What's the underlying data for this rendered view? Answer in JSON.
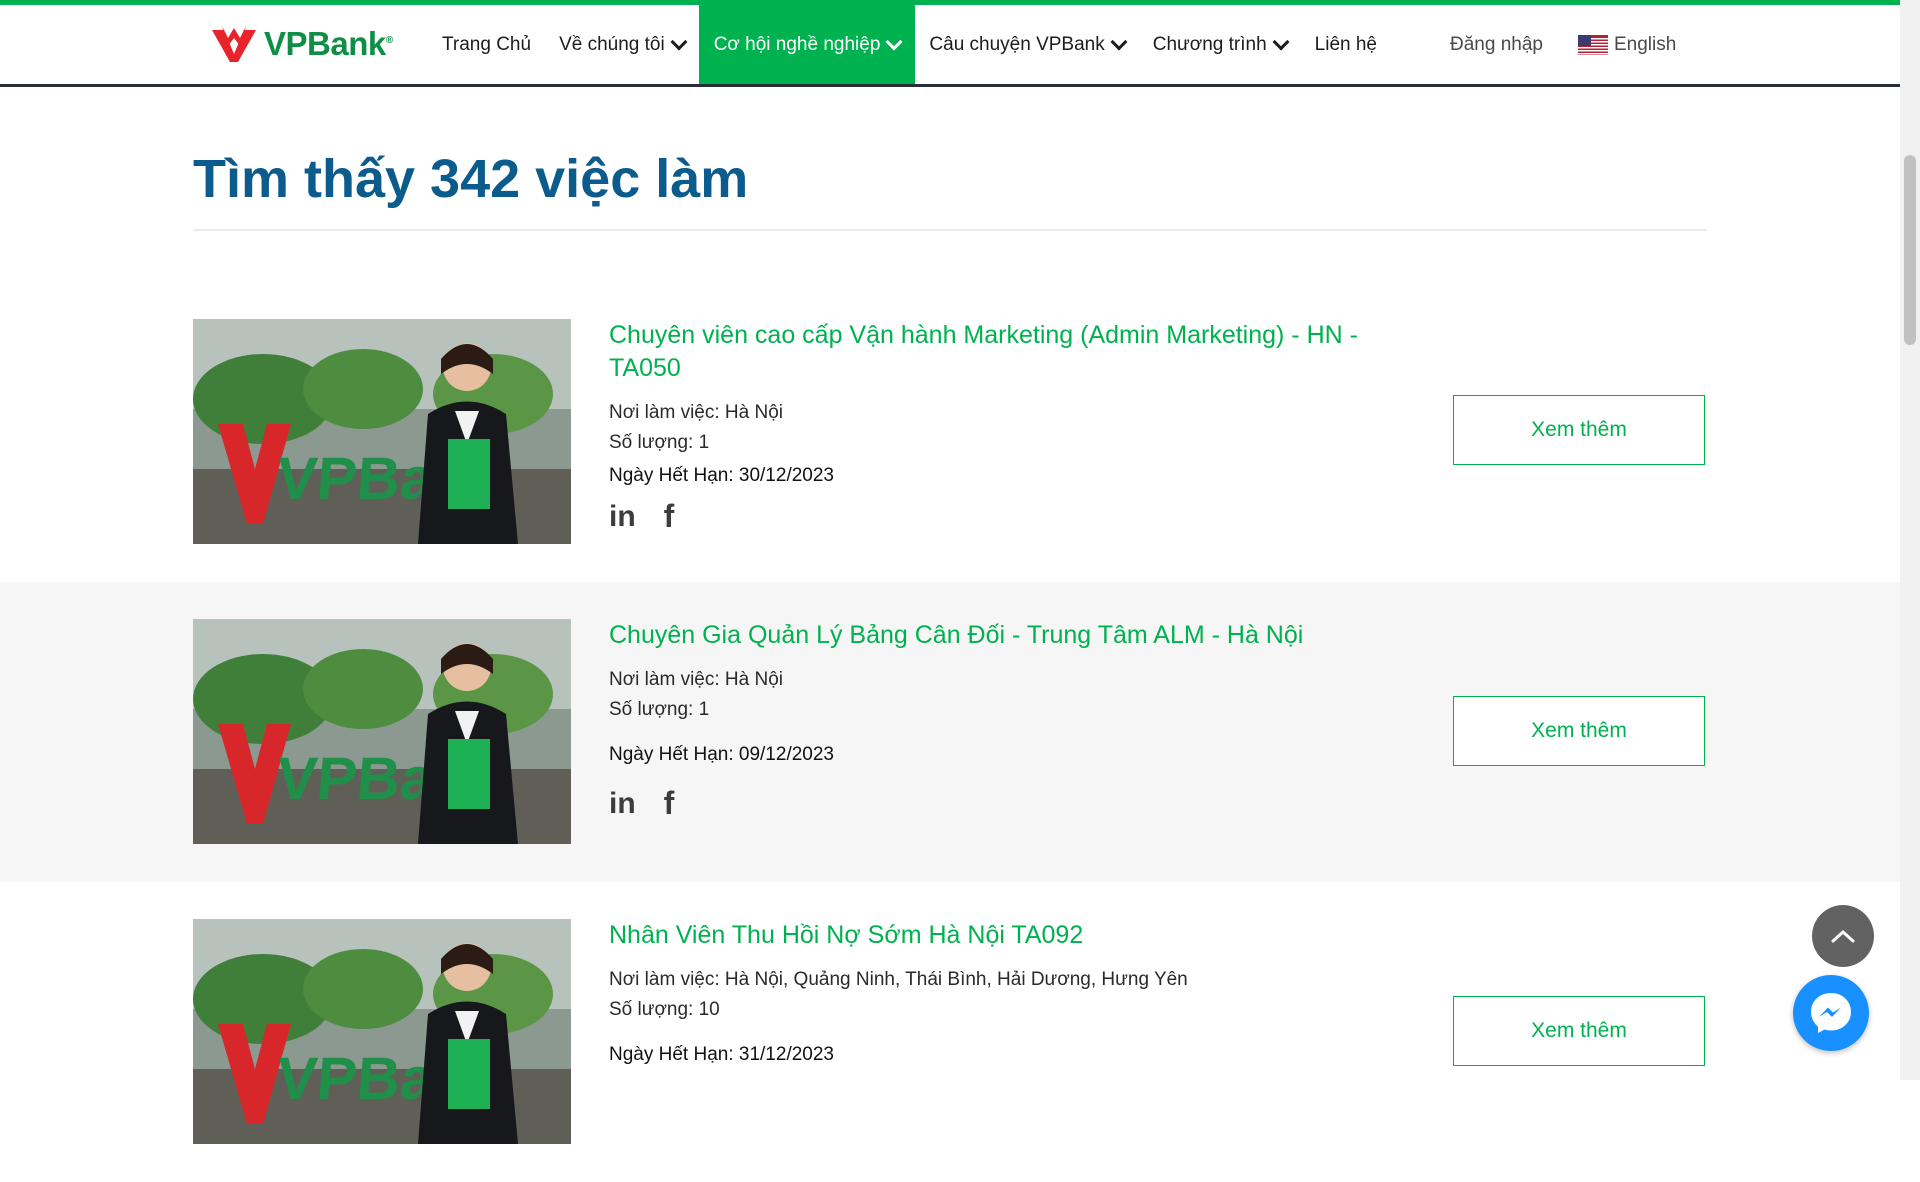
{
  "brand": {
    "name": "VPBank",
    "accent": "#00b14f",
    "logo_red": "#e8232a"
  },
  "nav": {
    "items": [
      {
        "label": "Trang Chủ",
        "dropdown": false,
        "active": false
      },
      {
        "label": "Về chúng tôi",
        "dropdown": true,
        "active": false
      },
      {
        "label": "Cơ hội nghề nghiệp",
        "dropdown": true,
        "active": true
      },
      {
        "label": "Câu chuyện VPBank",
        "dropdown": true,
        "active": false
      },
      {
        "label": "Chương trình",
        "dropdown": true,
        "active": false
      },
      {
        "label": "Liên hệ",
        "dropdown": false,
        "active": false
      }
    ],
    "login": "Đăng nhập",
    "language": "English"
  },
  "page": {
    "title": "Tìm thấy 342 việc làm"
  },
  "jobs": [
    {
      "title": "Chuyên viên cao cấp Vận hành Marketing (Admin Marketing) - HN - TA050",
      "location": "Nơi làm việc: Hà Nội",
      "quantity": "Số lượng: 1",
      "deadline": "Ngày Hết Hạn: 30/12/2023",
      "button": "Xem thêm"
    },
    {
      "title": "Chuyên Gia Quản Lý Bảng Cân Đối - Trung Tâm ALM - Hà Nội",
      "location": "Nơi làm việc: Hà Nội",
      "quantity": "Số lượng: 1",
      "deadline": "Ngày Hết Hạn: 09/12/2023",
      "button": "Xem thêm"
    },
    {
      "title": "Nhân Viên Thu Hồi Nợ Sớm Hà Nội TA092",
      "location": "Nơi làm việc: Hà Nội, Quảng Ninh, Thái Bình, Hải Dương, Hưng Yên",
      "quantity": "Số lượng: 10",
      "deadline": "Ngày Hết Hạn: 31/12/2023",
      "button": "Xem thêm"
    }
  ],
  "social": {
    "linkedin": "in",
    "facebook": "f"
  },
  "icons": {
    "scroll_top": "chevron-up-icon",
    "messenger": "messenger-icon"
  }
}
